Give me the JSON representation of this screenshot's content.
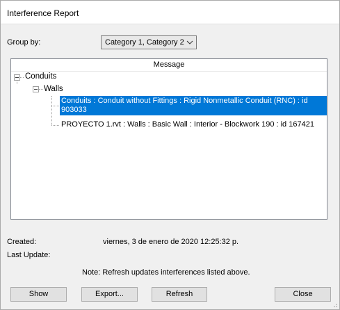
{
  "window": {
    "title": "Interference Report"
  },
  "group_by": {
    "label": "Group by:",
    "value": "Category 1, Category 2"
  },
  "tree": {
    "column_header": "Message",
    "root": {
      "label": "Conduits"
    },
    "child": {
      "label": "Walls"
    },
    "items": [
      {
        "line1": "Conduits : Conduit without Fittings : Rigid Nonmetallic Conduit (RNC) : id",
        "line2": "903033",
        "selected": true
      },
      {
        "line1": "PROYECTO 1.rvt : Walls : Basic Wall : Interior - Blockwork 190 : id 167421",
        "selected": false
      }
    ]
  },
  "info": {
    "created_label": "Created:",
    "created_value": "viernes, 3 de enero de 2020 12:25:32 p.",
    "last_update_label": "Last Update:",
    "note": "Note: Refresh updates interferences listed above."
  },
  "buttons": {
    "show": "Show",
    "export": "Export...",
    "refresh": "Refresh",
    "close": "Close"
  },
  "colors": {
    "selection": "#0078d7"
  }
}
